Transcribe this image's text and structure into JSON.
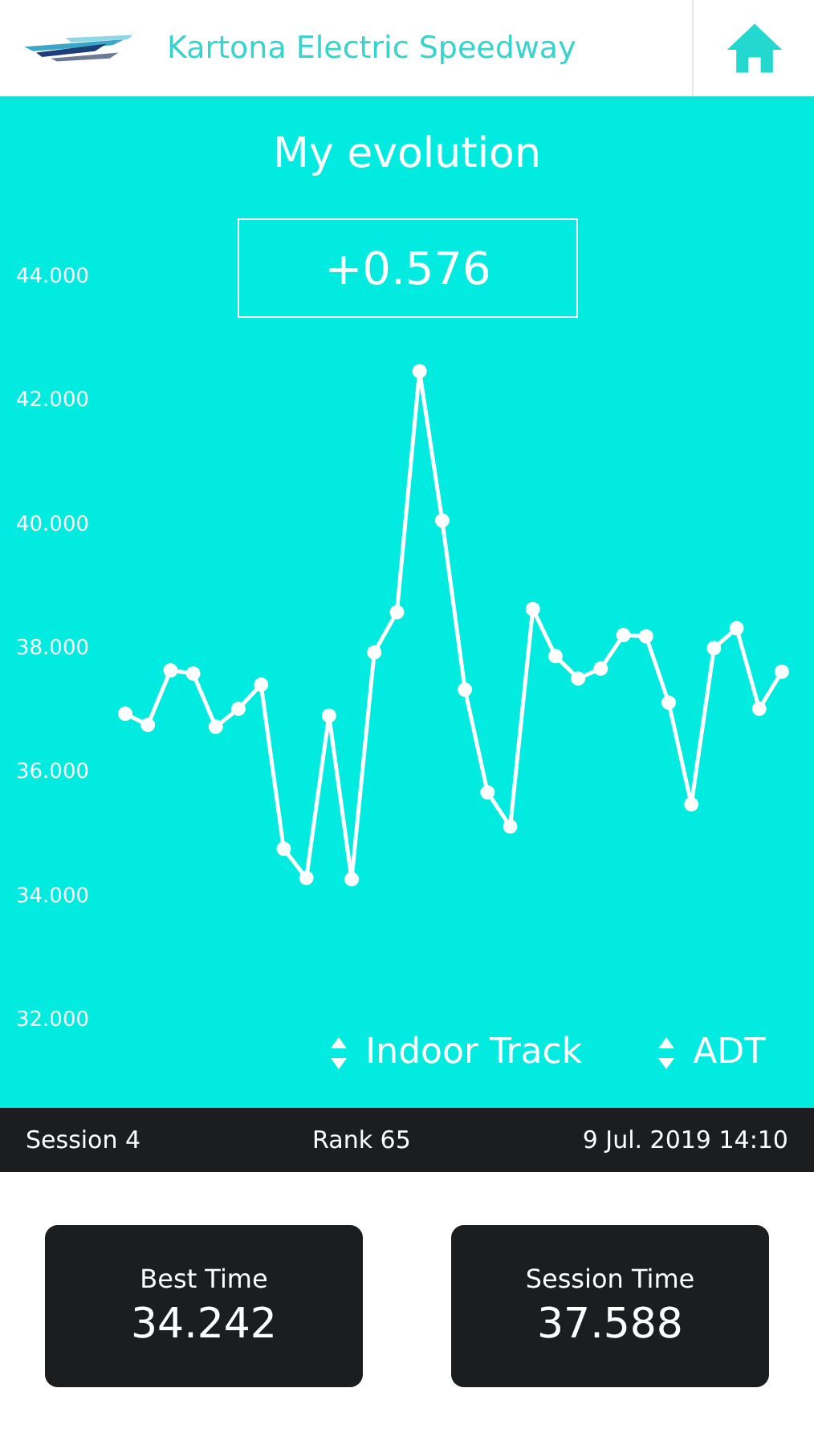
{
  "header": {
    "title": "Kartona Electric Speedway"
  },
  "evolution": {
    "title": "My evolution",
    "delta": "+0.576",
    "chart_data": {
      "type": "line",
      "categories": [
        null,
        null,
        null,
        null,
        null,
        null,
        null,
        null,
        null,
        null,
        null,
        null,
        null,
        null,
        null,
        null,
        null,
        null,
        null,
        null,
        null,
        null,
        null,
        null,
        null,
        null,
        null,
        null,
        null,
        null
      ],
      "series": [
        {
          "color": "#ffffff",
          "marker": "circle",
          "values": [
            36.91,
            36.73,
            37.61,
            37.56,
            36.7,
            36.99,
            37.38,
            34.73,
            34.26,
            36.88,
            34.24,
            37.9,
            38.55,
            42.44,
            40.03,
            37.3,
            35.64,
            35.09,
            38.6,
            37.84,
            37.48,
            37.64,
            38.18,
            38.16,
            37.09,
            35.45,
            37.97,
            38.29,
            36.99,
            37.59
          ]
        }
      ],
      "ylim": [
        32,
        44
      ],
      "yticks": [
        {
          "value": 44,
          "label": "44.000"
        },
        {
          "value": 42,
          "label": "42.000"
        },
        {
          "value": 40,
          "label": "40.000"
        },
        {
          "value": 38,
          "label": "38.000"
        },
        {
          "value": 36,
          "label": "36.000"
        },
        {
          "value": 34,
          "label": "34.000"
        },
        {
          "value": 32,
          "label": "32.000"
        }
      ]
    },
    "filters": [
      {
        "label": "Indoor Track"
      },
      {
        "label": "ADT"
      }
    ]
  },
  "session_bar": {
    "session": "Session 4",
    "rank": "Rank 65",
    "date": "9 Jul. 2019 14:10"
  },
  "cards": [
    {
      "label": "Best Time",
      "value": "34.242"
    },
    {
      "label": "Session Time",
      "value": "37.588"
    }
  ]
}
